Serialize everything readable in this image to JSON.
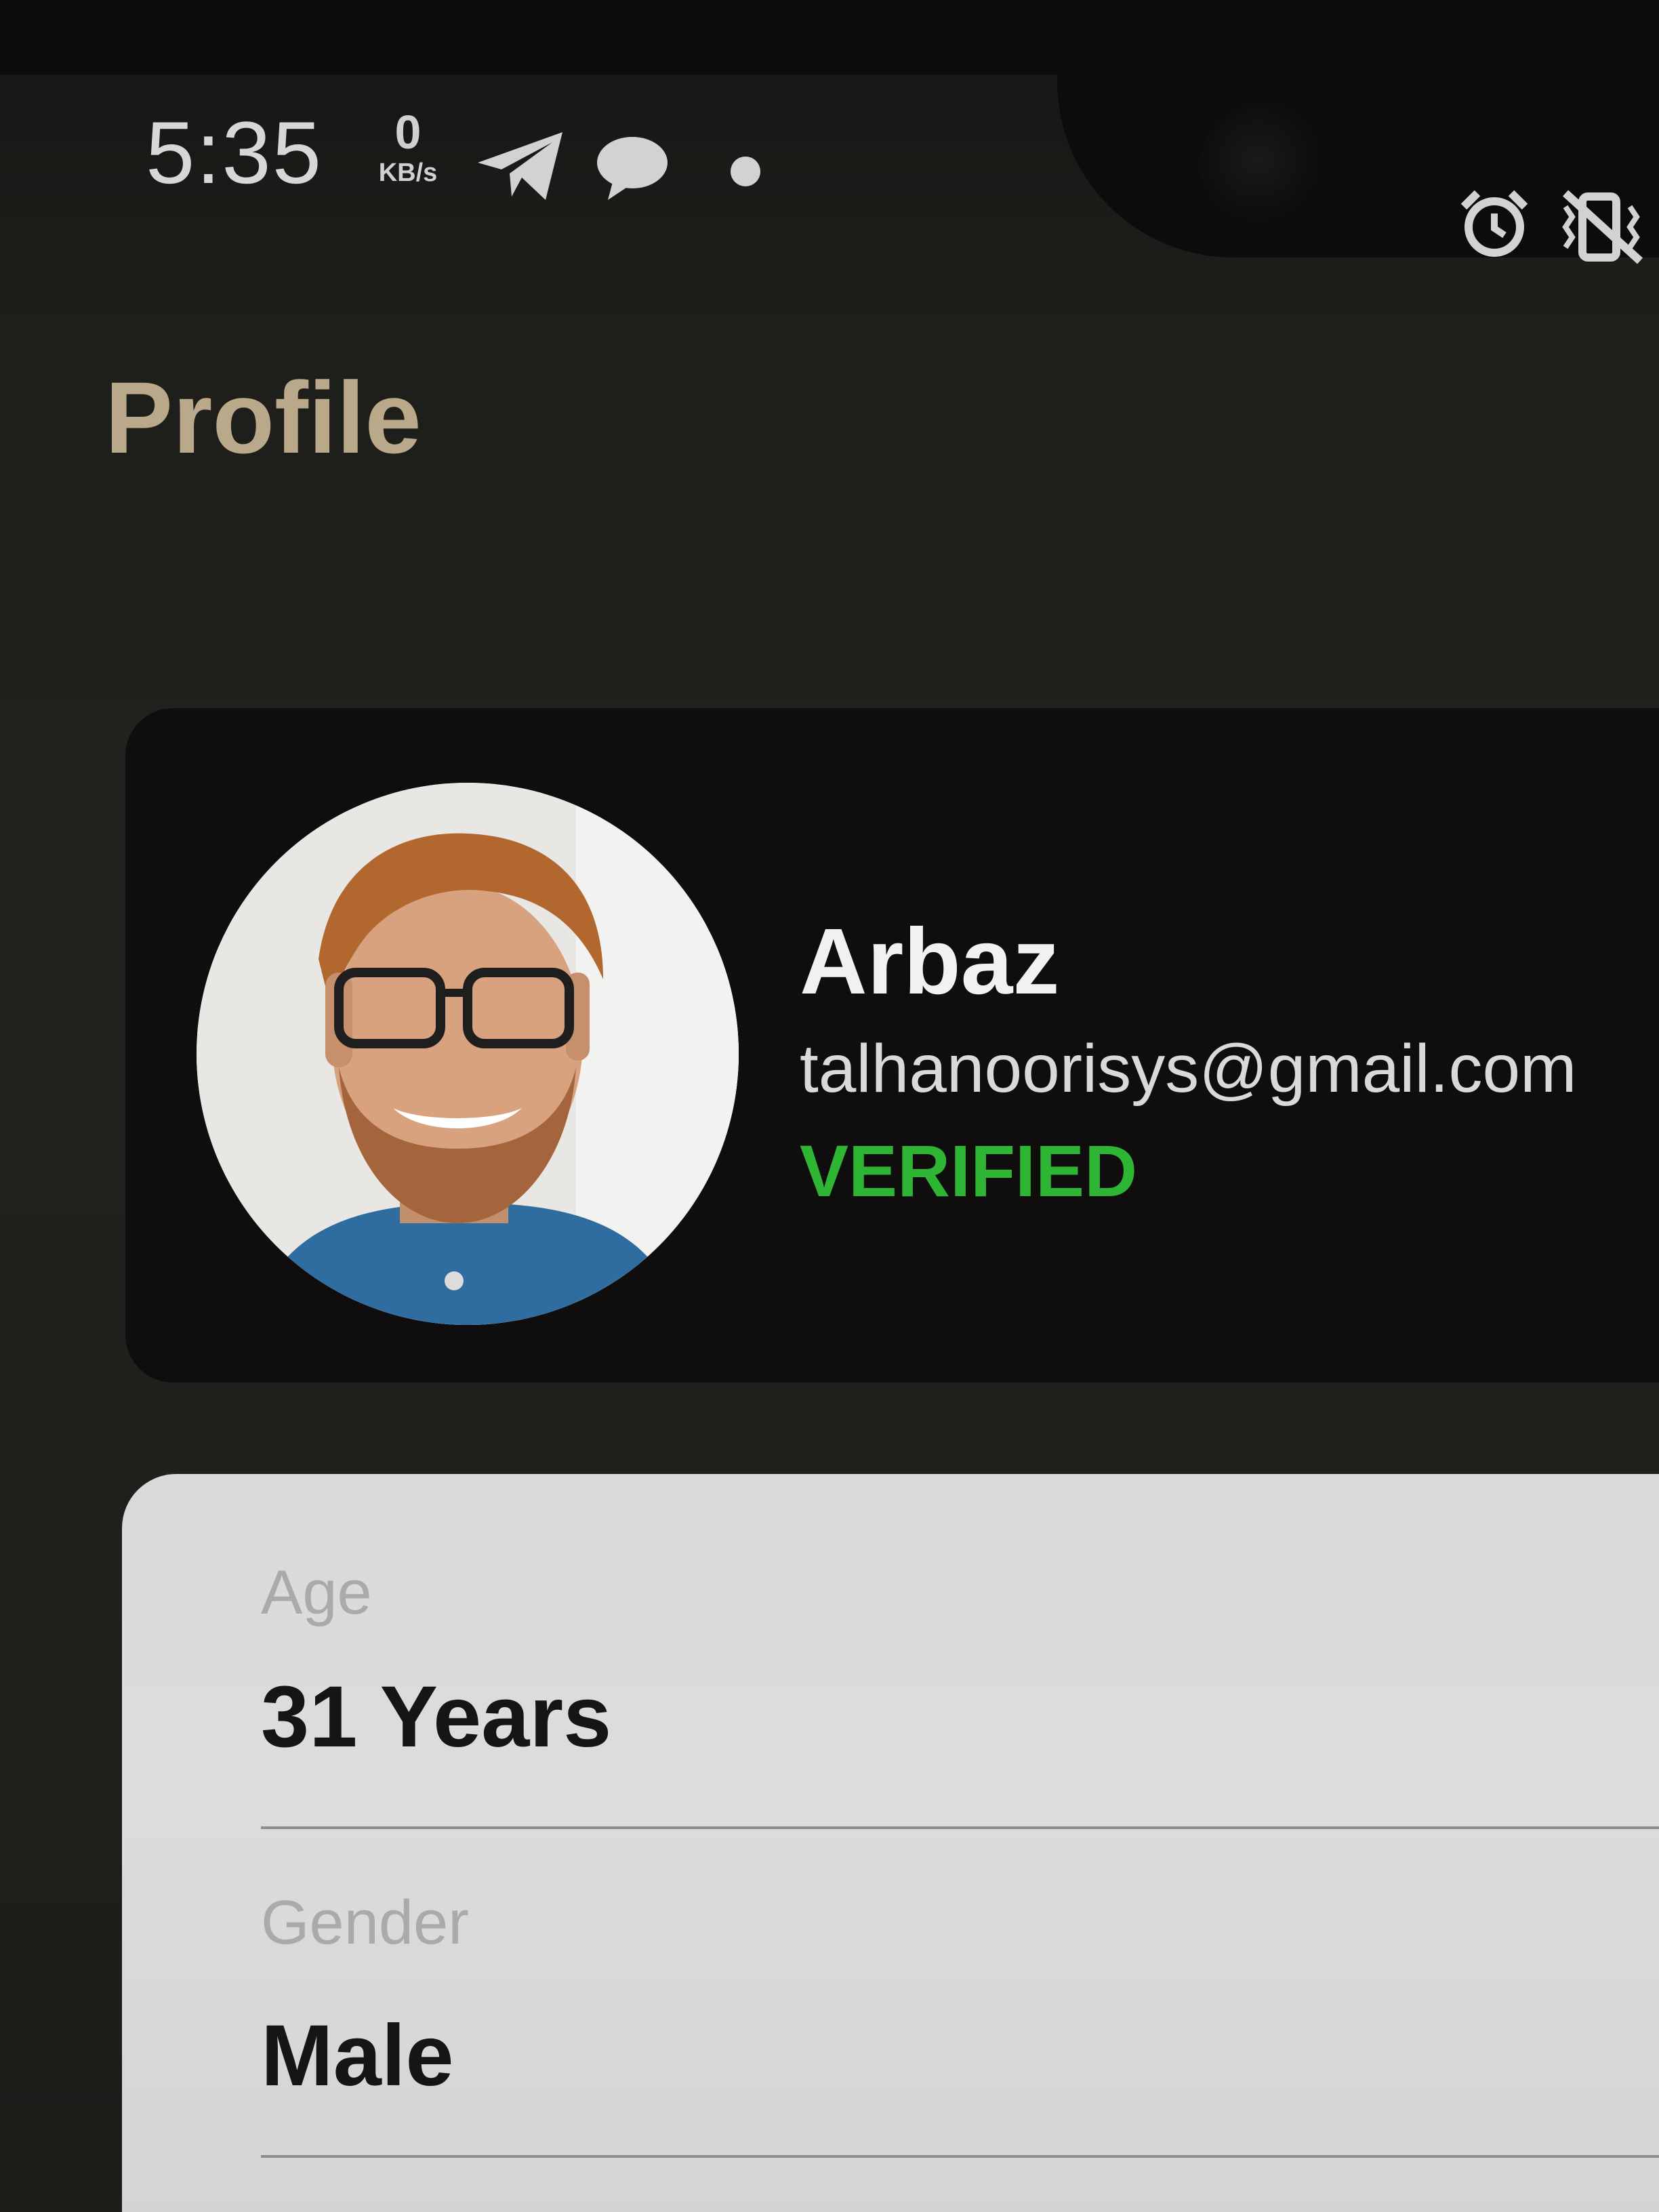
{
  "status_bar": {
    "time": "5:35",
    "net_speed_value": "0",
    "net_speed_unit": "KB/s",
    "icons": [
      "telegram-icon",
      "chat-bubble-icon",
      "notification-dot-icon",
      "alarm-icon",
      "vibrate-icon"
    ]
  },
  "header": {
    "title": "Profile"
  },
  "profile": {
    "name": "Arbaz",
    "email": "talhanoorisys@gmail.com",
    "status": "VERIFIED",
    "status_color": "#2fb534"
  },
  "details": [
    {
      "label": "Age",
      "value": "31 Years"
    },
    {
      "label": "Gender",
      "value": "Male"
    }
  ],
  "colors": {
    "title": "#b9a98a",
    "card_dark": "#0f0d0d",
    "card_light": "#d9dadb"
  }
}
